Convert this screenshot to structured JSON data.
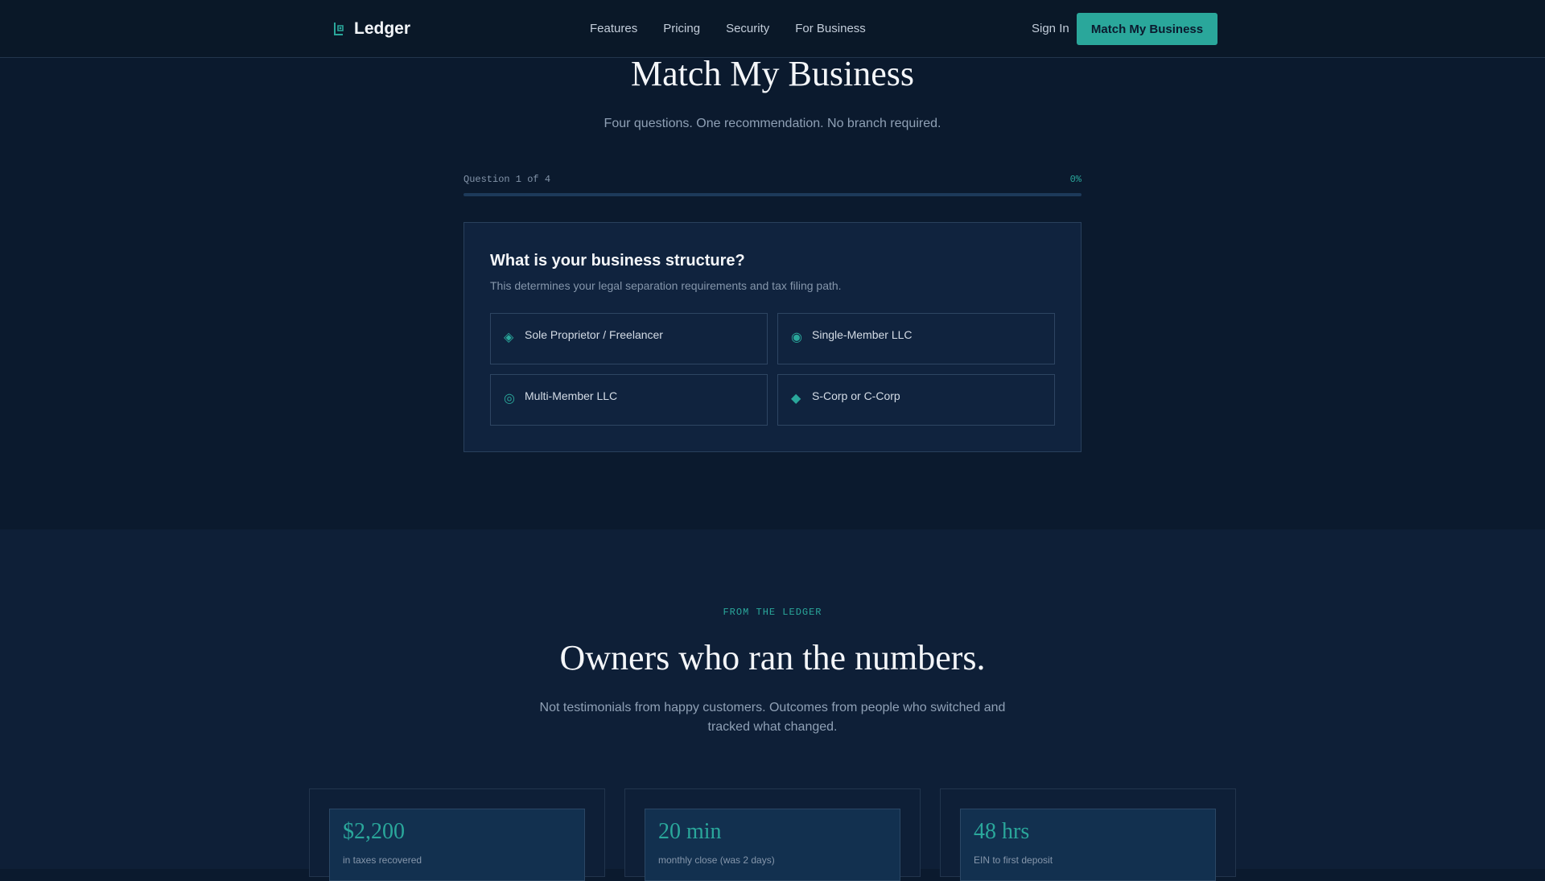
{
  "nav": {
    "brand": "Ledger",
    "links": [
      "Features",
      "Pricing",
      "Security",
      "For Business"
    ],
    "signin": "Sign In",
    "cta": "Match My Business"
  },
  "hero": {
    "title": "Match My Business",
    "subtitle": "Four questions. One recommendation. No branch required."
  },
  "progress": {
    "label": "Question 1 of 4",
    "percent_text": "0%",
    "fraction": 0
  },
  "question": {
    "title": "What is your business structure?",
    "description": "This determines your legal separation requirements and tax filing path.",
    "options": [
      {
        "label": "Sole Proprietor / Freelancer",
        "icon": "diamond-outline-icon",
        "glyph": "◈"
      },
      {
        "label": "Single-Member LLC",
        "icon": "circle-dot-icon",
        "glyph": "◉"
      },
      {
        "label": "Multi-Member LLC",
        "icon": "bullseye-icon",
        "glyph": "◎"
      },
      {
        "label": "S-Corp or C-Corp",
        "icon": "diamond-filled-icon",
        "glyph": "◆"
      }
    ]
  },
  "section2": {
    "eyebrow": "FROM THE LEDGER",
    "title": "Owners who ran the numbers.",
    "subtitle": "Not testimonials from happy customers. Outcomes from people who switched and tracked what changed.",
    "stats": [
      {
        "value": "$2,200",
        "label": "in taxes recovered"
      },
      {
        "value": "20 min",
        "label": "monthly close (was 2 days)"
      },
      {
        "value": "48 hrs",
        "label": "EIN to first deposit"
      }
    ]
  },
  "colors": {
    "accent": "#2aa79b",
    "background": "#0b1a2e",
    "card": "#10233e"
  }
}
